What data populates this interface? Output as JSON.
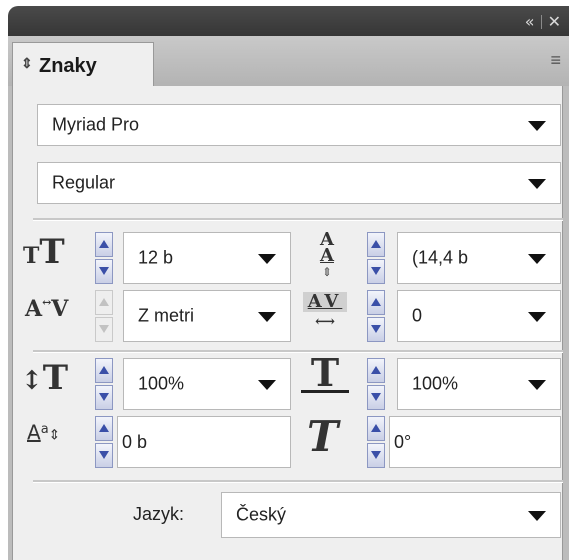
{
  "window": {
    "collapse_icon": "«",
    "close_icon": "✕"
  },
  "tab": {
    "label": "Znaky",
    "arrows_icon": "⇕"
  },
  "panel_menu_icon": "≡",
  "font_family": {
    "value": "Myriad Pro"
  },
  "font_style": {
    "value": "Regular"
  },
  "font_size": {
    "value": "12 b",
    "icon": "font-size-icon"
  },
  "leading": {
    "value": "(14,4 b",
    "icon": "leading-icon"
  },
  "kerning": {
    "value": "Z metri",
    "icon": "kerning-icon"
  },
  "tracking": {
    "value": "0",
    "icon": "tracking-icon"
  },
  "vertical_scale": {
    "value": "100%",
    "icon": "vertical-scale-icon"
  },
  "horizontal_scale": {
    "value": "100%",
    "icon": "horizontal-scale-icon"
  },
  "baseline_shift": {
    "value": "0 b",
    "icon": "baseline-shift-icon"
  },
  "skew": {
    "value": "0°",
    "icon": "skew-icon"
  },
  "language": {
    "label": "Jazyk:",
    "value": "Český"
  }
}
